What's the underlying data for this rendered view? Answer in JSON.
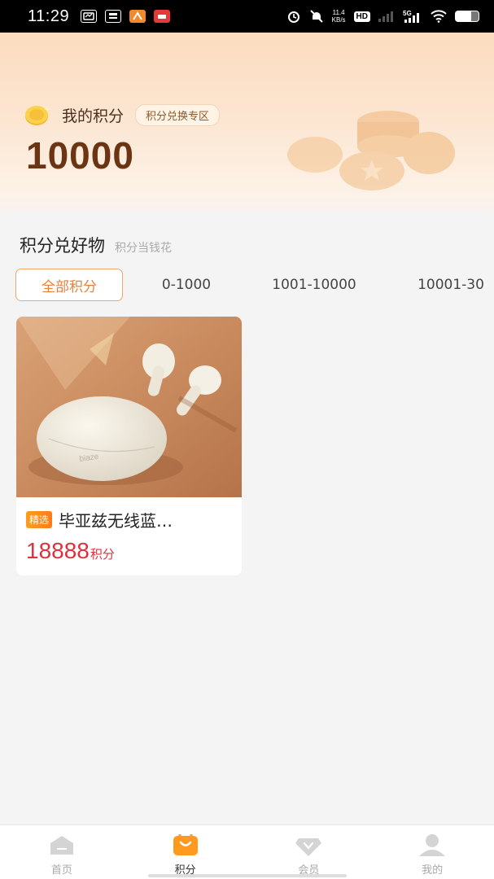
{
  "status_bar": {
    "time": "11:29",
    "speed_value": "11.4",
    "speed_unit": "KB/s",
    "hd_label": "HD",
    "network": "5G"
  },
  "header": {
    "points_label": "我的积分",
    "exchange_badge": "积分兑换专区",
    "points_value": "10000"
  },
  "section": {
    "title": "积分兑好物",
    "subtitle": "积分当钱花"
  },
  "filter_tabs": [
    {
      "label": "全部积分",
      "active": true
    },
    {
      "label": "0-1000",
      "active": false
    },
    {
      "label": "1001-10000",
      "active": false
    },
    {
      "label": "10001-30",
      "active": false
    }
  ],
  "products": [
    {
      "tag": "精选",
      "name": "毕亚兹无线蓝…",
      "price": "18888",
      "price_unit": "积分",
      "brand_on_image": "biaze"
    }
  ],
  "bottom_nav": [
    {
      "label": "首页",
      "icon": "home-icon",
      "active": false
    },
    {
      "label": "积分",
      "icon": "points-bag-icon",
      "active": true
    },
    {
      "label": "会员",
      "icon": "vip-diamond-icon",
      "active": false
    },
    {
      "label": "我的",
      "icon": "profile-icon",
      "active": false
    }
  ],
  "colors": {
    "accent": "#e8823a",
    "price": "#e0303d",
    "points_value": "#6b3412",
    "header_bg": "#fbdcc0"
  }
}
